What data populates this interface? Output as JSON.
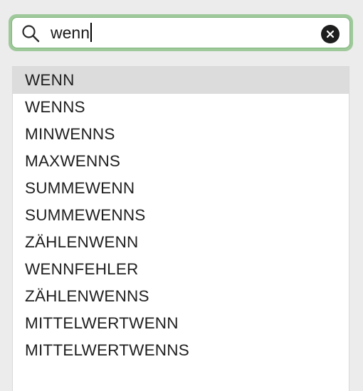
{
  "search": {
    "value": "wenn"
  },
  "icons": {
    "search": "search-icon",
    "clear": "clear-icon"
  },
  "colors": {
    "focus_ring": "#9fc99b",
    "selected_row": "#dcdcdc"
  },
  "list": {
    "selected_index": 0,
    "items": [
      {
        "label": "WENN"
      },
      {
        "label": "WENNS"
      },
      {
        "label": "MINWENNS"
      },
      {
        "label": "MAXWENNS"
      },
      {
        "label": "SUMMEWENN"
      },
      {
        "label": "SUMMEWENNS"
      },
      {
        "label": "ZÄHLENWENN"
      },
      {
        "label": "WENNFEHLER"
      },
      {
        "label": "ZÄHLENWENNS"
      },
      {
        "label": "MITTELWERTWENN"
      },
      {
        "label": "MITTELWERTWENNS"
      }
    ]
  }
}
